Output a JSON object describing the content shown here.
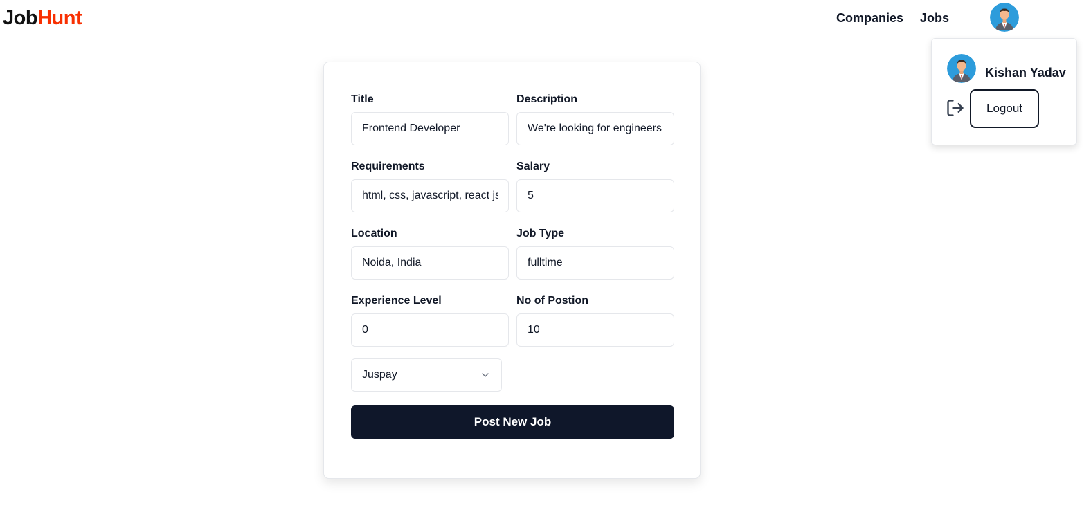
{
  "navbar": {
    "logo_part1": "Job",
    "logo_part2": "Hunt",
    "links": [
      "Companies",
      "Jobs"
    ],
    "avatar_icon": "user-avatar-icon"
  },
  "profile_popover": {
    "name": "Kishan Yadav",
    "logout_label": "Logout",
    "logout_icon": "log-out-icon"
  },
  "form": {
    "fields": [
      {
        "label": "Title",
        "value": "Frontend Developer"
      },
      {
        "label": "Description",
        "value": "We're looking for engineers"
      },
      {
        "label": "Requirements",
        "value": "html, css, javascript, react js"
      },
      {
        "label": "Salary",
        "value": "5"
      },
      {
        "label": "Location",
        "value": "Noida, India"
      },
      {
        "label": "Job Type",
        "value": "fulltime"
      },
      {
        "label": "Experience Level",
        "value": "0"
      },
      {
        "label": "No of Postion",
        "value": "10"
      }
    ],
    "company_select": {
      "value": "Juspay",
      "icon": "chevron-down-icon"
    },
    "submit_label": "Post New Job"
  },
  "colors": {
    "brand_accent": "#F83002",
    "primary_button": "#0F172A",
    "avatar_bg": "#2D9CDB"
  }
}
